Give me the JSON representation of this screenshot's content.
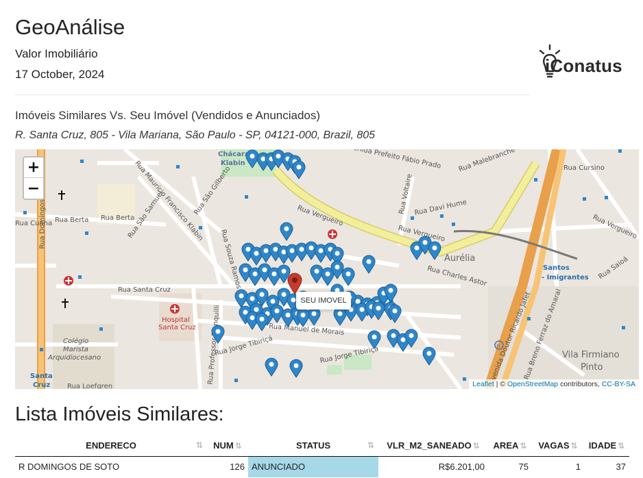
{
  "header": {
    "title": "GeoAnálise",
    "subtitle": "Valor Imobiliário",
    "date": "17 October, 2024",
    "logo_text": "iConatus"
  },
  "map_section": {
    "heading": "Imóveis Similares Vs. Seu Imóvel (Vendidos e Anunciados)",
    "address": "R. Santa Cruz, 805 - Vila Mariana, São Paulo - SP, 04121-000, Brazil, 805",
    "zoom_in": "+",
    "zoom_out": "−",
    "popup": "SEU IMOVEL",
    "attribution": {
      "leaflet": "Leaflet",
      "sep": " | © ",
      "osm": "OpenStreetMap",
      "contrib": " contributors, ",
      "license": "CC-BY-SA"
    },
    "labels": {
      "chacara": "Chácara",
      "klabin": "Klabin",
      "prefeito": "Avenida Prefeito Fábio Prado",
      "malebranche": "Rua Malebranche",
      "vergueiro1": "Rua Vergueiro",
      "vergueiro2": "Rua Vergueiro",
      "vergueiro3": "Rua Vergueiro",
      "davi_hume": "Rua Davi Hume",
      "voltaire": "Rua Voltaire",
      "berta1": "Rua Berta",
      "berta2": "Rua Berta",
      "cunha": "Rua Cunha",
      "domingos": "Rua Domingos de",
      "sao_samuel": "Rua São Samuel",
      "sao_gilberto": "Rua São Gilberto",
      "mauricio": "Rua Maurício Francisco Klabin",
      "souza_ramos": "Rua Souza Ramos",
      "aurelia": "Aurélia",
      "charles_astor": "Rua Charles Astor",
      "santos": "Santos",
      "imigrantes": "- Imigrantes",
      "saioa": "Rua Saioá",
      "santa_cruz": "Rua Santa Cruz",
      "hospital": "Hospital",
      "hospital2": "Santa Cruz",
      "manuel": "Rua Manuel de Morais",
      "tibirica1": "Rua Jorge Tibiriçá",
      "tibirica2": "Rua Jorge Tibiriçá",
      "colegio": "Colégio",
      "marista": "Marista",
      "arqui": "Arquidiocesano",
      "vila_firmiano": "Vila Firmiano",
      "pinto": "Pinto",
      "santa_station": "Santa",
      "cruz_station": "Cruz",
      "loefgren": "Rua Loefgren",
      "ricardo": "Avenida Doutor Ricardo Jafet",
      "breno": "Rua Breno Ferraz do Amaral",
      "trancoso": "Rua Professor Tranquilli",
      "imprensa": "Rua Imprensa",
      "sena": "Rua Sena Madureira",
      "cursino": "Rua Cursino"
    }
  },
  "list": {
    "title": "Lista Imóveis Similares:",
    "columns": [
      "ENDERECO",
      "NUM",
      "STATUS",
      "VLR_M2_SANEADO",
      "AREA",
      "VAGAS",
      "IDADE"
    ],
    "rows": [
      [
        "R DOMINGOS DE SOTO",
        "126",
        "ANUNCIADO",
        "R$6.201,00",
        "75",
        "1",
        "37"
      ]
    ]
  },
  "colors": {
    "marker": "#2f86c9",
    "own_marker": "#c93a2b",
    "status_cell": "#a7d8e8",
    "map_bg": "#ebe6df",
    "vergueiro_road": "#f2ef9a",
    "highway": "#e8a04a",
    "park": "#c9e8c3"
  },
  "icons": [
    "plus-icon",
    "minus-icon",
    "map-marker-icon",
    "hospital-icon",
    "church-cross-icon",
    "metro-icon",
    "sort-icon",
    "lightbulb-icon"
  ]
}
